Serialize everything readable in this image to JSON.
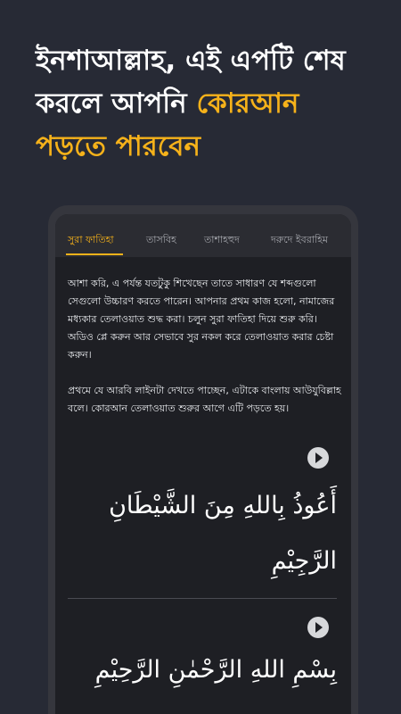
{
  "headline": {
    "line1": "ইনশাআল্লাহ, এই এপটি শেষ",
    "line2_white": "করলে আপনি ",
    "line2_accent": "কোরআন",
    "line3": "পড়তে পারবেন"
  },
  "tabs": [
    {
      "label": "সুরা ফাতিহা",
      "active": true
    },
    {
      "label": "তাসবিহ",
      "active": false
    },
    {
      "label": "তাশাহহুদ",
      "active": false
    },
    {
      "label": "দরুদে ইবরাহিম",
      "active": false
    }
  ],
  "content": {
    "para1": "আশা করি, এ পর্যন্ত যতটুকু শিখেছেন তাতে সাধারণ যে শব্দগুলো সেগুলো উচ্চারণ করতে পারেন। আপনার প্রথম কাজ হলো, নামাজের মধ্যকার তেলাওয়াত শুদ্ধ করা। চলুন সুরা ফাতিহা দিয়ে শুরু করি। অডিও প্লে করুন আর সেভাবে সুর নকল করে তেলাওয়াত করার চেষ্টা করুন।",
    "para2": "প্রথমে যে আরবি লাইনটা দেখতে পাচ্ছেন, এটাকে বাংলায় আউযুবিল্লাহ বলে। কোরআন তেলাওয়াত শুরুর আগে এটি পড়তে হয়।",
    "verse1": "أَعُوذُ بِاللهِ مِنَ الشَّيْطَانِ الرَّجِيْمِ",
    "verse2": "بِسْمِ اللهِ الرَّحْمٰنِ الرَّحِيْمِ"
  },
  "icons": {
    "play": "play-icon"
  },
  "colors": {
    "background": "#272a35",
    "accent": "#f6b21a",
    "screen": "#1e1f24"
  }
}
